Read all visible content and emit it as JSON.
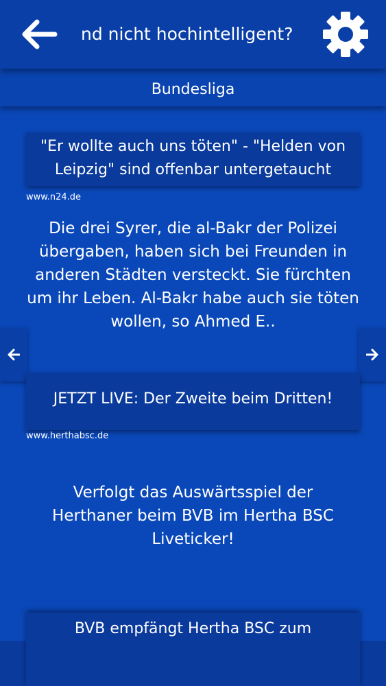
{
  "header": {
    "title": "nd nicht hochintelligent?",
    "back_icon": "arrow-left-icon",
    "settings_icon": "gear-icon"
  },
  "category": {
    "label": "Bundesliga"
  },
  "articles": [
    {
      "title": "\"Er wollte auch uns töten\" - \"Helden von Leipzig\" sind offenbar untergetaucht",
      "source": "www.n24.de",
      "text": "Die drei Syrer, die al-Bakr der Polizei übergaben, haben sich bei Freunden in anderen Städten versteckt. Sie fürchten um ihr Leben. Al-Bakr habe auch sie töten wollen, so Ahmed E.."
    },
    {
      "title": "JETZT LIVE: Der Zweite beim Dritten!",
      "source": "www.herthabsc.de",
      "text": "Verfolgt das Auswärtsspiel der Herthaner beim BVB im Hertha BSC Liveticker!"
    },
    {
      "title": "BVB empfängt Hertha BSC zum"
    }
  ],
  "nav": {
    "prev_icon": "arrow-left-small-icon",
    "next_icon": "arrow-right-small-icon"
  },
  "colors": {
    "background": "#0a48b9",
    "bar": "#0a3fa8",
    "title_box": "#0a3a9c",
    "text": "#ffffff"
  }
}
